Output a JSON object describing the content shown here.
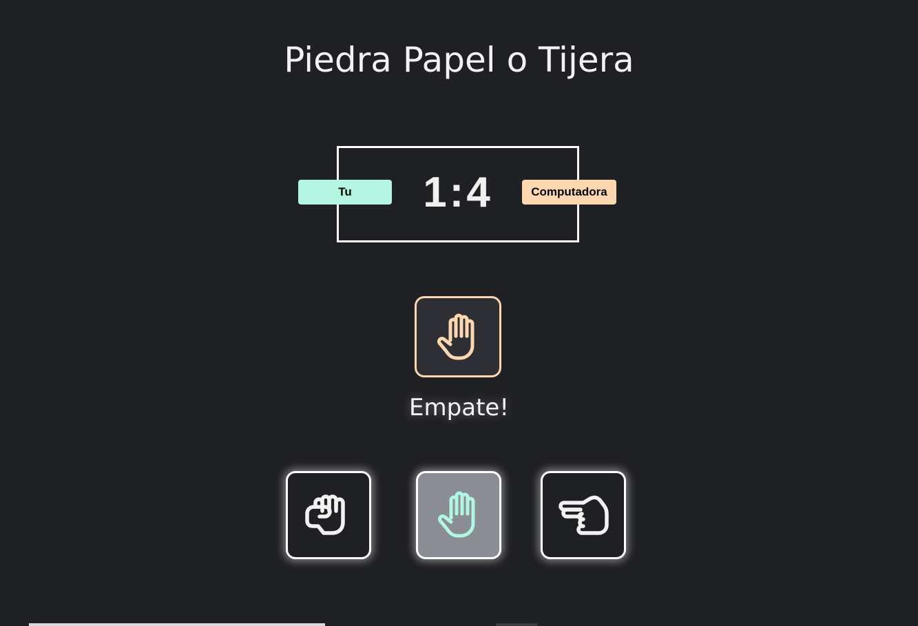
{
  "title": "Piedra Papel o Tijera",
  "scoreboard": {
    "user_label": "Tu",
    "cpu_label": "Computadora",
    "user_score": "1",
    "separator": ":",
    "cpu_score": "4"
  },
  "computer_choice": {
    "icon": "hand-paper-icon",
    "accent": "#fdd7af"
  },
  "result_text": "Empate!",
  "choices": [
    {
      "id": "rock",
      "icon": "hand-rock-icon",
      "selected": false
    },
    {
      "id": "paper",
      "icon": "hand-paper-icon",
      "selected": true,
      "accent": "#b2f5e0"
    },
    {
      "id": "scissors",
      "icon": "hand-scissors-icon",
      "selected": false
    }
  ],
  "colors": {
    "background": "#1f2024",
    "user_badge": "#b2f5e0",
    "cpu_badge": "#fdd7af"
  }
}
